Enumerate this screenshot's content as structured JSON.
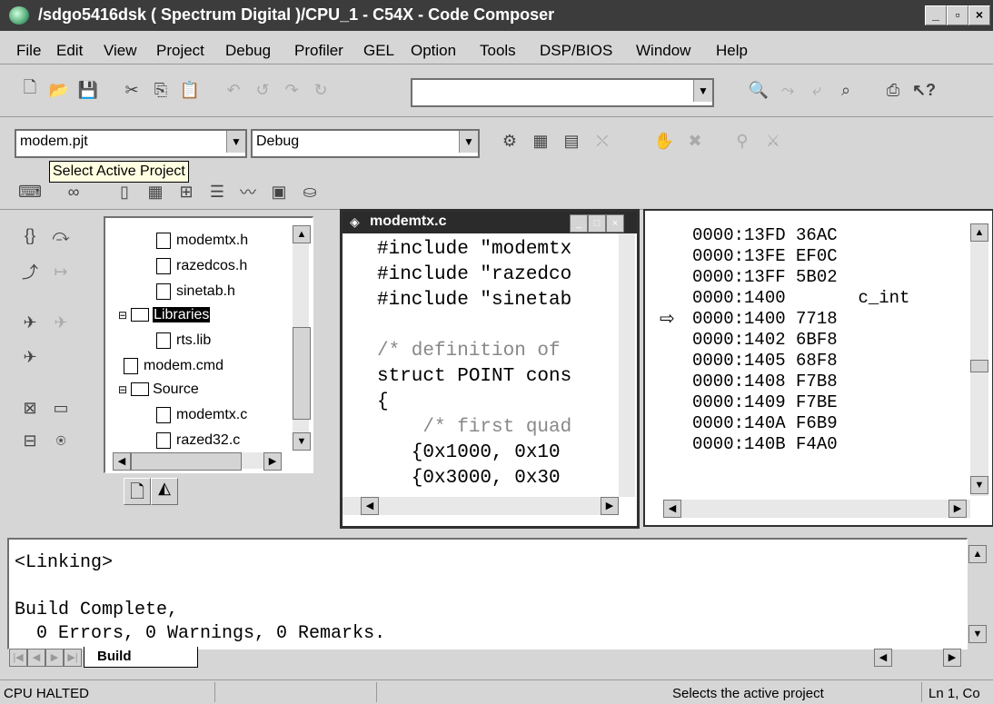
{
  "window": {
    "title": "/sdgo5416dsk ( Spectrum Digital )/CPU_1 - C54X - Code Composer",
    "min_label": "_",
    "max_label": "▫",
    "close_label": "×"
  },
  "menu": [
    "File",
    "Edit",
    "View",
    "Project",
    "Debug",
    "Profiler",
    "GEL",
    "Option",
    "Tools",
    "DSP/BIOS",
    "Window",
    "Help"
  ],
  "toolbar2": {
    "project": "modem.pjt",
    "config": "Debug",
    "tooltip": "Select Active Project"
  },
  "project_tree": {
    "items": [
      {
        "type": "file",
        "label": "modemtx.h"
      },
      {
        "type": "file",
        "label": "razedcos.h"
      },
      {
        "type": "file",
        "label": "sinetab.h"
      },
      {
        "type": "folder",
        "label": "Libraries"
      },
      {
        "type": "lib",
        "label": "rts.lib"
      },
      {
        "type": "file",
        "label": "modem.cmd"
      },
      {
        "type": "folder",
        "label": "Source"
      },
      {
        "type": "src",
        "label": "modemtx.c"
      },
      {
        "type": "src",
        "label": "razed32.c"
      }
    ]
  },
  "editor": {
    "title": "modemtx.c",
    "lines": [
      "#include \"modemtx",
      "#include \"razedco",
      "#include \"sinetab",
      "",
      "/* definition of",
      "struct POINT cons",
      "{",
      "    /* first quad",
      "   {0x1000, 0x10",
      "   {0x3000, 0x30"
    ]
  },
  "disassembly": {
    "lines": [
      {
        "addr": "0000:13FD",
        "op": "36AC",
        "sym": ""
      },
      {
        "addr": "0000:13FE",
        "op": "EF0C",
        "sym": ""
      },
      {
        "addr": "0000:13FF",
        "op": "5B02",
        "sym": ""
      },
      {
        "addr": "0000:1400",
        "op": "",
        "sym": "c_int"
      },
      {
        "addr": "0000:1400",
        "op": "7718",
        "sym": ""
      },
      {
        "addr": "0000:1402",
        "op": "6BF8",
        "sym": ""
      },
      {
        "addr": "0000:1405",
        "op": "68F8",
        "sym": ""
      },
      {
        "addr": "0000:1408",
        "op": "F7B8",
        "sym": ""
      },
      {
        "addr": "0000:1409",
        "op": "F7BE",
        "sym": ""
      },
      {
        "addr": "0000:140A",
        "op": "F6B9",
        "sym": ""
      },
      {
        "addr": "0000:140B",
        "op": "F4A0",
        "sym": ""
      }
    ],
    "pc_marker": "⇨"
  },
  "output": {
    "lines": [
      "<Linking>",
      "",
      "Build Complete,",
      "  0 Errors, 0 Warnings, 0 Remarks."
    ],
    "tab": "Build"
  },
  "status": {
    "left": "CPU HALTED",
    "message": "Selects the active project",
    "position": "Ln 1, Co"
  }
}
